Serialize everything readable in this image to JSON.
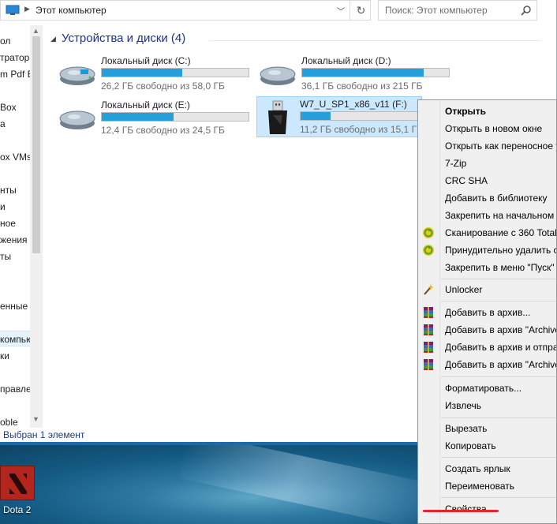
{
  "address": {
    "location": "Этот компьютер"
  },
  "search": {
    "placeholder": "Поиск: Этот компьютер"
  },
  "sidebar": {
    "items": [
      {
        "label": "ол"
      },
      {
        "label": "тратор"
      },
      {
        "label": "m Pdf E"
      },
      {
        "label": ""
      },
      {
        "label": "Box"
      },
      {
        "label": "а"
      },
      {
        "label": ""
      },
      {
        "label": "ox VMs"
      },
      {
        "label": ""
      },
      {
        "label": "нты"
      },
      {
        "label": "и"
      },
      {
        "label": "ное"
      },
      {
        "label": "жения"
      },
      {
        "label": "ты"
      },
      {
        "label": ""
      },
      {
        "label": ""
      },
      {
        "label": "енные"
      },
      {
        "label": ""
      },
      {
        "label": "компьютер"
      },
      {
        "label": "ки"
      },
      {
        "label": ""
      },
      {
        "label": "правле"
      },
      {
        "label": ""
      },
      {
        "label": "oble"
      }
    ]
  },
  "status": {
    "text": "Выбран 1 элемент"
  },
  "group": {
    "title": "Устройства и диски (4)"
  },
  "drives": [
    {
      "name": "Локальный диск (C:)",
      "free": "26,2 ГБ свободно из 58,0 ГБ",
      "used_fraction": 0.55
    },
    {
      "name": "Локальный диск (D:)",
      "free": "36,1 ГБ свободно из 215 ГБ",
      "used_fraction": 0.83
    },
    {
      "name": "Локальный диск (E:)",
      "free": "12,4 ГБ свободно из 24,5 ГБ",
      "used_fraction": 0.49
    },
    {
      "name": "W7_U_SP1_x86_v11 (F:)",
      "free": "11,2 ГБ свободно из 15,1 ГБ",
      "used_fraction": 0.26
    }
  ],
  "context_menu": {
    "items": [
      {
        "label": "Открыть",
        "icon": ""
      },
      {
        "label": "Открыть в новом окне",
        "icon": ""
      },
      {
        "label": "Открыть как переносное у",
        "icon": ""
      },
      {
        "label": "7-Zip",
        "icon": ""
      },
      {
        "label": "CRC SHA",
        "icon": ""
      },
      {
        "label": "Добавить в библиотеку",
        "icon": ""
      },
      {
        "label": "Закрепить на начальном э",
        "icon": ""
      },
      {
        "label": "Сканирование с 360 Total",
        "icon": "360-total-security-icon"
      },
      {
        "label": "Принудительно удалить с",
        "icon": "360-total-security-icon"
      },
      {
        "label": "Закрепить в меню \"Пуск\"",
        "icon": ""
      },
      {
        "label": "Unlocker",
        "icon": "magic-wand-icon"
      },
      {
        "label": "Добавить в архив...",
        "icon": "winrar-icon"
      },
      {
        "label": "Добавить в архив \"Archive",
        "icon": "winrar-icon"
      },
      {
        "label": "Добавить в архив и отпра",
        "icon": "winrar-icon"
      },
      {
        "label": "Добавить в архив \"Archive",
        "icon": "winrar-icon"
      },
      {
        "label": "Форматировать...",
        "icon": ""
      },
      {
        "label": "Извлечь",
        "icon": ""
      },
      {
        "label": "Вырезать",
        "icon": ""
      },
      {
        "label": "Копировать",
        "icon": ""
      },
      {
        "label": "Создать ярлык",
        "icon": ""
      },
      {
        "label": "Переименовать",
        "icon": ""
      },
      {
        "label": "Свойства",
        "icon": ""
      }
    ]
  },
  "desktop": {
    "icon_label": "Dota 2"
  },
  "colors": {
    "bar_fill": "#26a0da",
    "selection": "#cce8ff",
    "annotation": "#e5252a"
  }
}
